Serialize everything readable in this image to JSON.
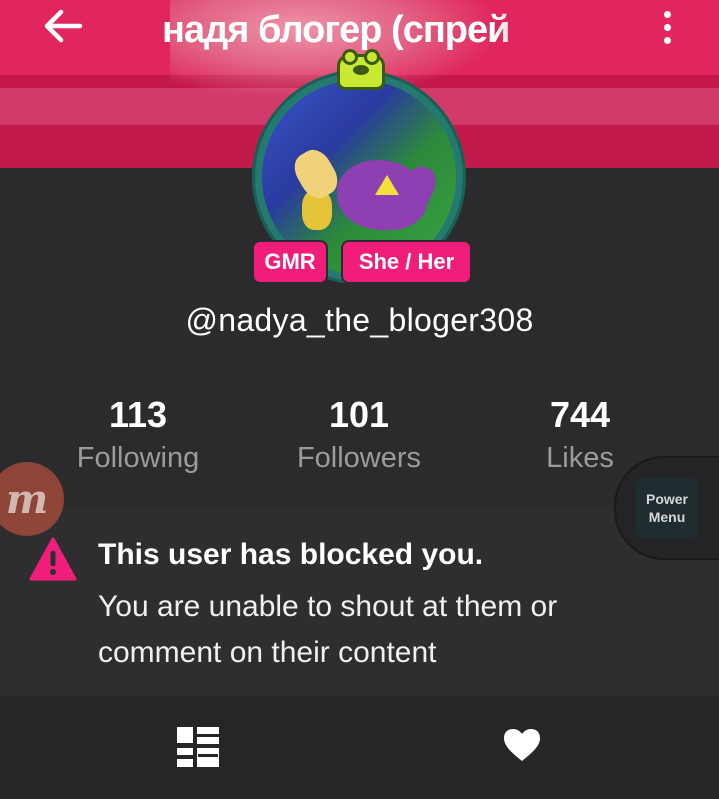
{
  "header": {
    "title": "надя блогер (спрей",
    "back_icon": "arrow-left-icon",
    "more_icon": "more-vertical-icon"
  },
  "profile": {
    "tags": [
      "GMR",
      "She / Her"
    ],
    "handle": "@nadya_the_bloger308"
  },
  "stats": [
    {
      "value": "113",
      "label": "Following"
    },
    {
      "value": "101",
      "label": "Followers"
    },
    {
      "value": "744",
      "label": "Likes"
    }
  ],
  "overlay": {
    "m_label": "m",
    "power_menu": "Power Menu"
  },
  "blocked": {
    "title": "This user has blocked you.",
    "message": "You are unable to shout at them or comment on their content"
  },
  "bottom_nav": {
    "items": [
      "grid-icon",
      "heart-icon"
    ]
  },
  "colors": {
    "accent": "#f01e7a",
    "header": "#e0265c",
    "background": "#2b2b2d"
  }
}
